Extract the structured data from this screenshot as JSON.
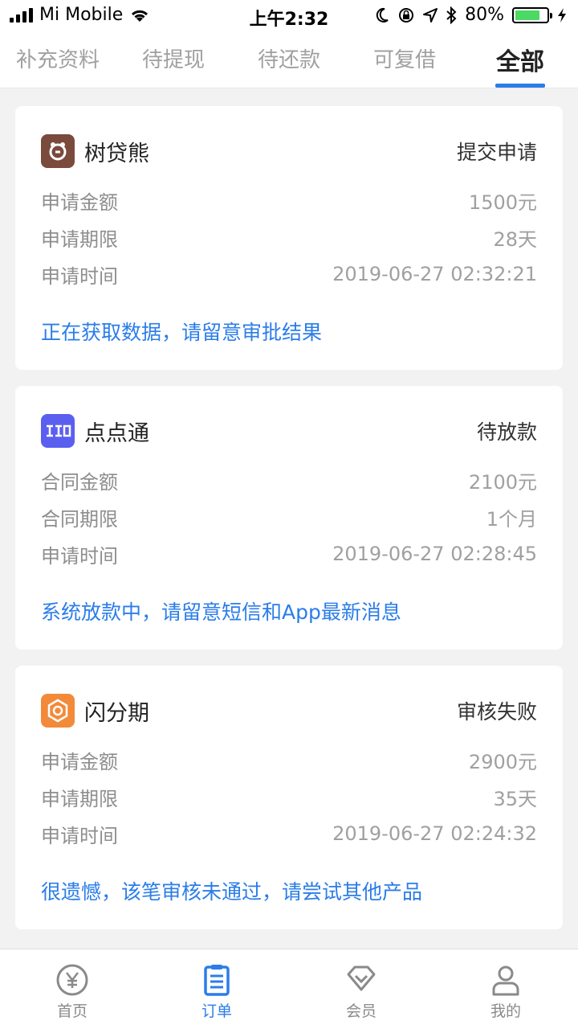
{
  "status_bar": {
    "carrier": "Mi Mobile",
    "time": "上午2:32",
    "battery": "80%",
    "battery_level": 0.8,
    "battery_color": "#4cd964"
  },
  "tabs": [
    {
      "label": "补充资料",
      "active": false
    },
    {
      "label": "待提现",
      "active": false
    },
    {
      "label": "待还款",
      "active": false
    },
    {
      "label": "可复借",
      "active": false
    },
    {
      "label": "全部",
      "active": true
    }
  ],
  "accent_color": "#2b7de9",
  "cards": [
    {
      "name": "树贷熊",
      "logo_icon": "bear-logo-icon",
      "logo_color": "#7a4a3d",
      "status": "提交申请",
      "rows": [
        {
          "label": "申请金额",
          "value": "1500元"
        },
        {
          "label": "申请期限",
          "value": "28天"
        },
        {
          "label": "申请时间",
          "value": "2019-06-27 02:32:21"
        }
      ],
      "notice": "正在获取数据，请留意审批结果"
    },
    {
      "name": "点点通",
      "logo_icon": "diandiantong-logo-icon",
      "logo_color": "#5b5ff0",
      "status": "待放款",
      "rows": [
        {
          "label": "合同金额",
          "value": "2100元"
        },
        {
          "label": "合同期限",
          "value": "1个月"
        },
        {
          "label": "申请时间",
          "value": "2019-06-27 02:28:45"
        }
      ],
      "notice": "系统放款中，请留意短信和App最新消息"
    },
    {
      "name": "闪分期",
      "logo_icon": "shanfenqi-logo-icon",
      "logo_color": "#f28a3a",
      "status": "审核失败",
      "rows": [
        {
          "label": "申请金额",
          "value": "2900元"
        },
        {
          "label": "申请期限",
          "value": "35天"
        },
        {
          "label": "申请时间",
          "value": "2019-06-27 02:24:32"
        }
      ],
      "notice": "很遗憾，该笔审核未通过，请尝试其他产品"
    }
  ],
  "bottom_nav": [
    {
      "label": "首页",
      "icon": "yen-coin-icon",
      "active": false
    },
    {
      "label": "订单",
      "icon": "clipboard-icon",
      "active": true
    },
    {
      "label": "会员",
      "icon": "diamond-icon",
      "active": false
    },
    {
      "label": "我的",
      "icon": "person-icon",
      "active": false
    }
  ]
}
